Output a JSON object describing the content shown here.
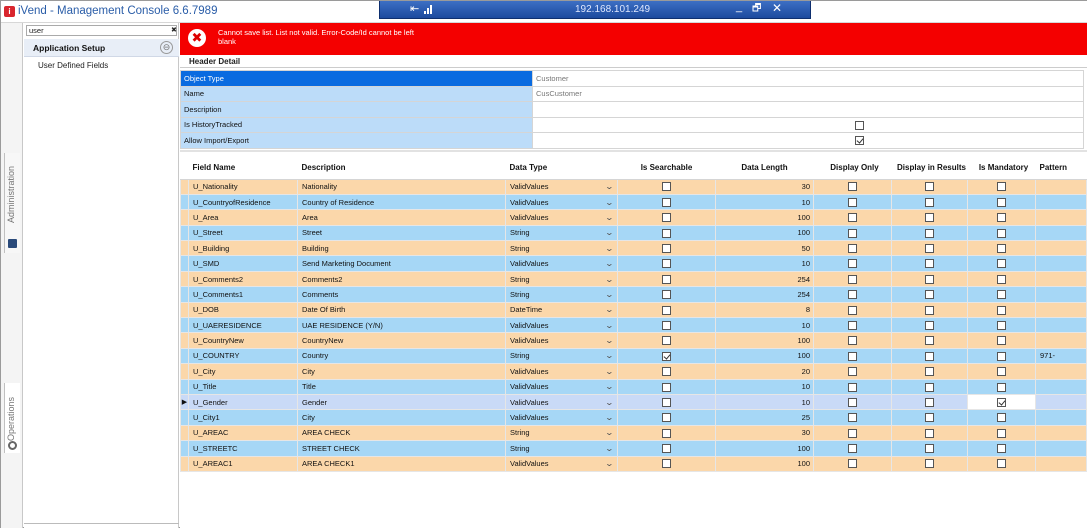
{
  "window": {
    "title": "iVend - Management Console 6.6.7989",
    "app_icon": "ivend-logo-icon"
  },
  "remote_bar": {
    "ip": "192.168.101.249",
    "pin_icon": "pin-icon",
    "signal_icon": "signal-icon",
    "minimize": "_",
    "restore": "🗗",
    "close": "✕"
  },
  "side_tabs": {
    "administration": "Administration",
    "operations": "Operations"
  },
  "left_panel": {
    "search_value": "user",
    "search_clear": "✖",
    "section_title": "Application Setup",
    "back_icon": "⊖",
    "items": [
      "User Defined Fields"
    ]
  },
  "error": {
    "message": "Cannot save list. List not valid. Error-Code/Id cannot be left blank",
    "icon": "✖",
    "color": "#f40000"
  },
  "header_detail": {
    "title": "Header Detail",
    "rows": [
      {
        "label": "Object Type",
        "value": "Customer"
      },
      {
        "label": "Name",
        "value": "CusCustomer"
      },
      {
        "label": "Description",
        "value": ""
      },
      {
        "label": "Is HistoryTracked",
        "checked": false
      },
      {
        "label": "Allow Import/Export",
        "checked": true
      }
    ]
  },
  "grid": {
    "columns": [
      "Field Name",
      "Description",
      "Data Type",
      "Is Searchable",
      "Data Length",
      "Display Only",
      "Display in Results",
      "Is Mandatory",
      "Pattern"
    ],
    "rows": [
      {
        "field": "U_Nationality",
        "desc": "Nationality",
        "type": "ValidValues",
        "searchable": false,
        "length": "30",
        "display_only": false,
        "in_results": false,
        "mandatory": false,
        "pattern": ""
      },
      {
        "field": "U_CountryofResidence",
        "desc": "Country of Residence",
        "type": "ValidValues",
        "searchable": false,
        "length": "10",
        "display_only": false,
        "in_results": false,
        "mandatory": false,
        "pattern": ""
      },
      {
        "field": "U_Area",
        "desc": "Area",
        "type": "ValidValues",
        "searchable": false,
        "length": "100",
        "display_only": false,
        "in_results": false,
        "mandatory": false,
        "pattern": ""
      },
      {
        "field": "U_Street",
        "desc": "Street",
        "type": "String",
        "searchable": false,
        "length": "100",
        "display_only": false,
        "in_results": false,
        "mandatory": false,
        "pattern": ""
      },
      {
        "field": "U_Building",
        "desc": "Building",
        "type": "String",
        "searchable": false,
        "length": "50",
        "display_only": false,
        "in_results": false,
        "mandatory": false,
        "pattern": ""
      },
      {
        "field": "U_SMD",
        "desc": "Send Marketing Document",
        "type": "ValidValues",
        "searchable": false,
        "length": "10",
        "display_only": false,
        "in_results": false,
        "mandatory": false,
        "pattern": ""
      },
      {
        "field": "U_Comments2",
        "desc": "Comments2",
        "type": "String",
        "searchable": false,
        "length": "254",
        "display_only": false,
        "in_results": false,
        "mandatory": false,
        "pattern": ""
      },
      {
        "field": "U_Comments1",
        "desc": "Comments",
        "type": "String",
        "searchable": false,
        "length": "254",
        "display_only": false,
        "in_results": false,
        "mandatory": false,
        "pattern": ""
      },
      {
        "field": "U_DOB",
        "desc": "Date Of Birth",
        "type": "DateTime",
        "searchable": false,
        "length": "8",
        "display_only": false,
        "in_results": false,
        "mandatory": false,
        "pattern": ""
      },
      {
        "field": "U_UAERESIDENCE",
        "desc": "UAE RESIDENCE (Y/N)",
        "type": "ValidValues",
        "searchable": false,
        "length": "10",
        "display_only": false,
        "in_results": false,
        "mandatory": false,
        "pattern": ""
      },
      {
        "field": "U_CountryNew",
        "desc": "CountryNew",
        "type": "ValidValues",
        "searchable": false,
        "length": "100",
        "display_only": false,
        "in_results": false,
        "mandatory": false,
        "pattern": ""
      },
      {
        "field": "U_COUNTRY",
        "desc": "Country",
        "type": "String",
        "searchable": true,
        "length": "100",
        "display_only": false,
        "in_results": false,
        "mandatory": false,
        "pattern": "971-"
      },
      {
        "field": "U_City",
        "desc": "City",
        "type": "ValidValues",
        "searchable": false,
        "length": "20",
        "display_only": false,
        "in_results": false,
        "mandatory": false,
        "pattern": ""
      },
      {
        "field": "U_Title",
        "desc": "Title",
        "type": "ValidValues",
        "searchable": false,
        "length": "10",
        "display_only": false,
        "in_results": false,
        "mandatory": false,
        "pattern": ""
      },
      {
        "field": "U_Gender",
        "desc": "Gender",
        "type": "ValidValues",
        "searchable": false,
        "length": "10",
        "display_only": false,
        "in_results": false,
        "mandatory": true,
        "pattern": "",
        "current": true
      },
      {
        "field": "U_City1",
        "desc": "City",
        "type": "ValidValues",
        "searchable": false,
        "length": "25",
        "display_only": false,
        "in_results": false,
        "mandatory": false,
        "pattern": ""
      },
      {
        "field": "U_AREAC",
        "desc": "AREA CHECK",
        "type": "String",
        "searchable": false,
        "length": "30",
        "display_only": false,
        "in_results": false,
        "mandatory": false,
        "pattern": ""
      },
      {
        "field": "U_STREETC",
        "desc": "STREET CHECK",
        "type": "String",
        "searchable": false,
        "length": "100",
        "display_only": false,
        "in_results": false,
        "mandatory": false,
        "pattern": ""
      },
      {
        "field": "U_AREAC1",
        "desc": "AREA CHECK1",
        "type": "ValidValues",
        "searchable": false,
        "length": "100",
        "display_only": false,
        "in_results": false,
        "mandatory": false,
        "pattern": ""
      }
    ],
    "row_colors": {
      "odd": "#fbd7aa",
      "even": "#a6d7f6",
      "current": "#c9daf7"
    },
    "row_indicator": "▶",
    "dropdown_icon": "chevron-down-icon"
  }
}
